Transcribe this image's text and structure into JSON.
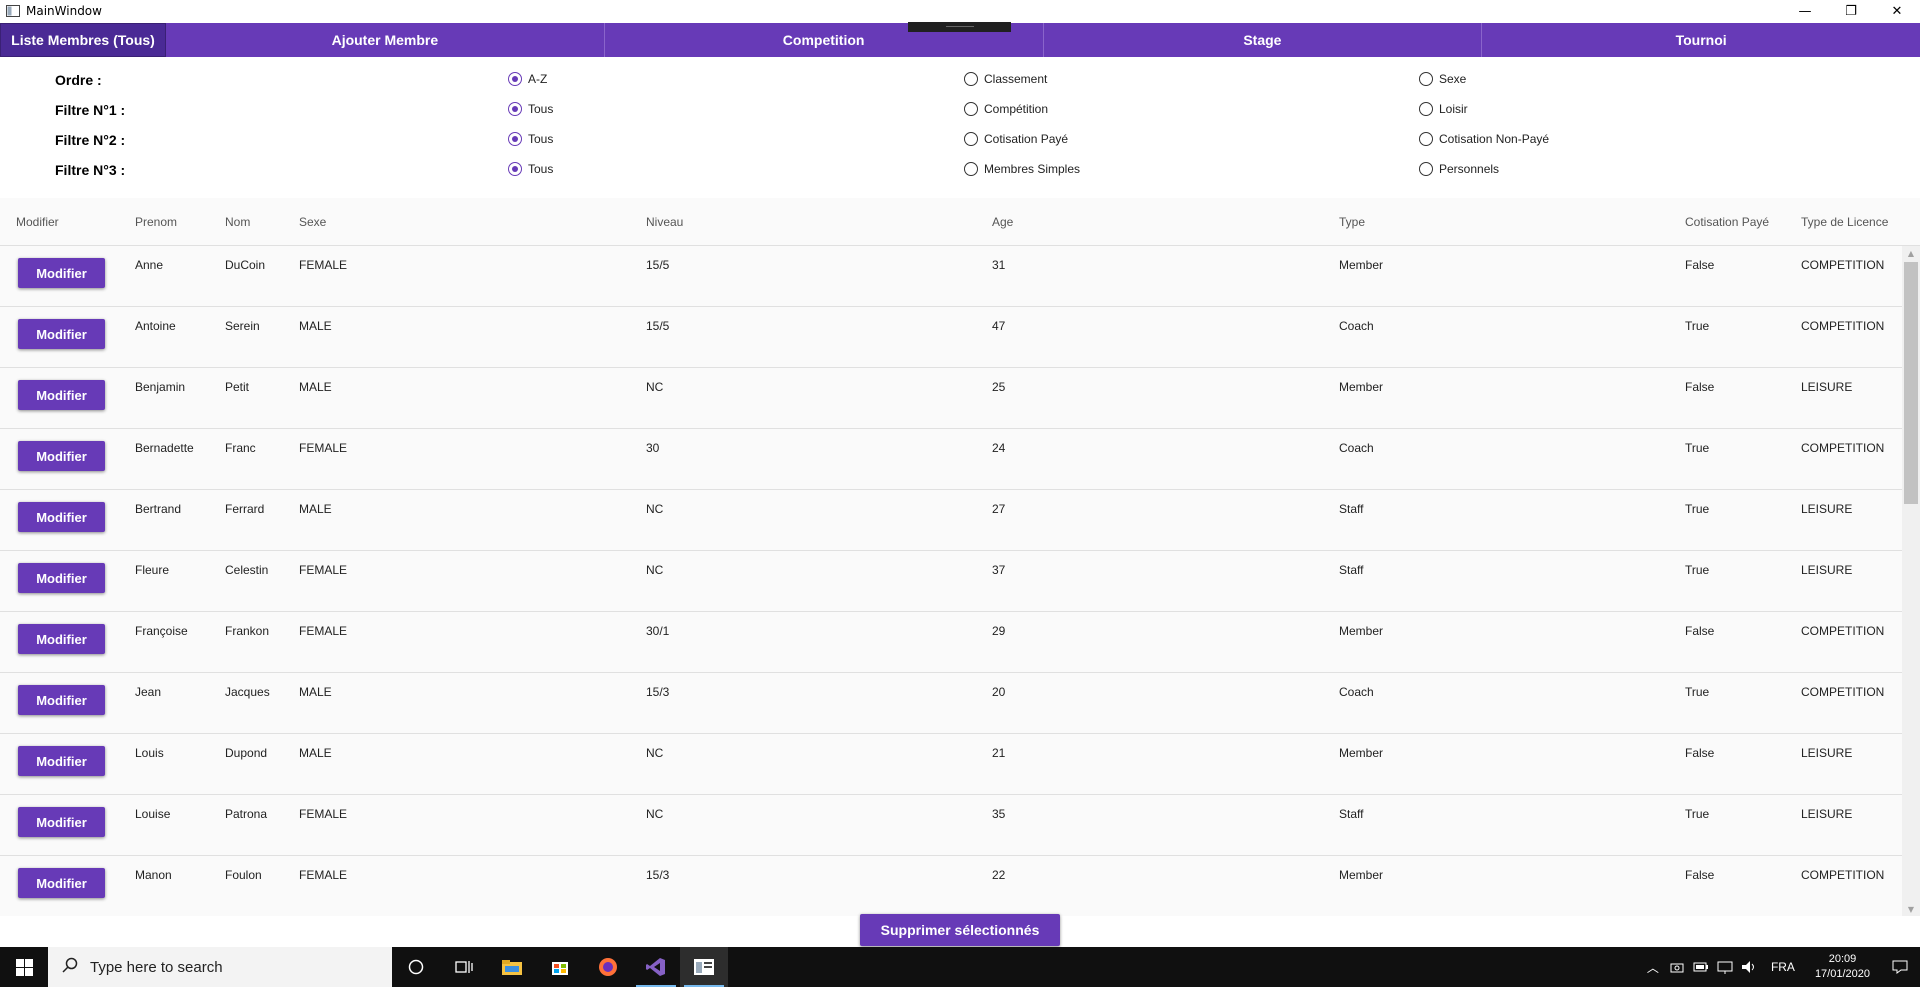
{
  "window": {
    "title": "MainWindow",
    "minimize_glyph": "—",
    "maximize_glyph": "❐",
    "close_glyph": "✕"
  },
  "nav": {
    "tabs": [
      {
        "label": "Liste Membres (Tous)",
        "active": true
      },
      {
        "label": "Ajouter Membre",
        "active": false
      },
      {
        "label": "Competition",
        "active": false
      },
      {
        "label": "Stage",
        "active": false
      },
      {
        "label": "Tournoi",
        "active": false
      }
    ]
  },
  "filters": {
    "rows": [
      {
        "label": "Ordre :",
        "options": [
          {
            "label": "A-Z",
            "checked": true
          },
          {
            "label": "Classement",
            "checked": false
          },
          {
            "label": "Sexe",
            "checked": false
          }
        ]
      },
      {
        "label": "Filtre N°1 :",
        "options": [
          {
            "label": "Tous",
            "checked": true
          },
          {
            "label": "Compétition",
            "checked": false
          },
          {
            "label": "Loisir",
            "checked": false
          }
        ]
      },
      {
        "label": "Filtre N°2 :",
        "options": [
          {
            "label": "Tous",
            "checked": true
          },
          {
            "label": "Cotisation Payé",
            "checked": false
          },
          {
            "label": "Cotisation Non-Payé",
            "checked": false
          }
        ]
      },
      {
        "label": "Filtre N°3 :",
        "options": [
          {
            "label": "Tous",
            "checked": true
          },
          {
            "label": "Membres Simples",
            "checked": false
          },
          {
            "label": "Personnels",
            "checked": false
          }
        ]
      }
    ]
  },
  "table": {
    "headers": [
      "Modifier",
      "Prenom",
      "Nom",
      "Sexe",
      "Niveau",
      "Age",
      "Type",
      "Cotisation Payé",
      "Type de Licence"
    ],
    "modify_label": "Modifier",
    "rows": [
      [
        "Anne",
        "DuCoin",
        "FEMALE",
        "15/5",
        "31",
        "Member",
        "False",
        "COMPETITION"
      ],
      [
        "Antoine",
        "Serein",
        "MALE",
        "15/5",
        "47",
        "Coach",
        "True",
        "COMPETITION"
      ],
      [
        "Benjamin",
        "Petit",
        "MALE",
        "NC",
        "25",
        "Member",
        "False",
        "LEISURE"
      ],
      [
        "Bernadette",
        "Franc",
        "FEMALE",
        "30",
        "24",
        "Coach",
        "True",
        "COMPETITION"
      ],
      [
        "Bertrand",
        "Ferrard",
        "MALE",
        "NC",
        "27",
        "Staff",
        "True",
        "LEISURE"
      ],
      [
        "Fleure",
        "Celestin",
        "FEMALE",
        "NC",
        "37",
        "Staff",
        "True",
        "LEISURE"
      ],
      [
        "Françoise",
        "Frankon",
        "FEMALE",
        "30/1",
        "29",
        "Member",
        "False",
        "COMPETITION"
      ],
      [
        "Jean",
        "Jacques",
        "MALE",
        "15/3",
        "20",
        "Coach",
        "True",
        "COMPETITION"
      ],
      [
        "Louis",
        "Dupond",
        "MALE",
        "NC",
        "21",
        "Member",
        "False",
        "LEISURE"
      ],
      [
        "Louise",
        "Patrona",
        "FEMALE",
        "NC",
        "35",
        "Staff",
        "True",
        "LEISURE"
      ],
      [
        "Manon",
        "Foulon",
        "FEMALE",
        "15/3",
        "22",
        "Member",
        "False",
        "COMPETITION"
      ]
    ]
  },
  "actions": {
    "delete_selected_label": "Supprimer sélectionnés"
  },
  "taskbar": {
    "search_placeholder": "Type here to search",
    "language": "FRA",
    "time": "20:09",
    "date": "17/01/2020"
  },
  "colors": {
    "accent": "#673ab7",
    "accent_dark": "#4a2a95"
  }
}
